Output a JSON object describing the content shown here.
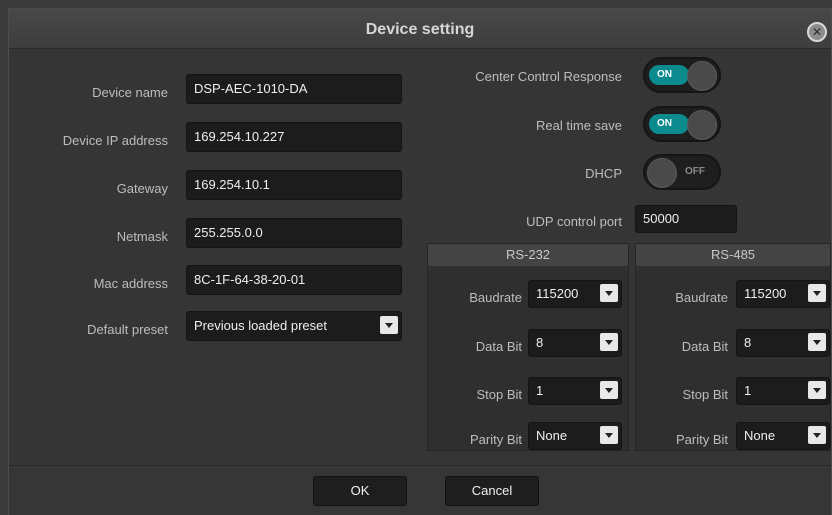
{
  "dialog": {
    "title": "Device setting",
    "close_label": "✕"
  },
  "left": {
    "device_name_label": "Device name",
    "device_name_value": "DSP-AEC-1010-DA",
    "ip_label": "Device IP address",
    "ip_value": "169.254.10.227",
    "gateway_label": "Gateway",
    "gateway_value": "169.254.10.1",
    "netmask_label": "Netmask",
    "netmask_value": "255.255.0.0",
    "mac_label": "Mac address",
    "mac_value": "8C-1F-64-38-20-01",
    "preset_label": "Default preset",
    "preset_value": "Previous loaded preset"
  },
  "right": {
    "center_control_label": "Center Control Response",
    "center_control_state": "ON",
    "realtime_label": "Real time save",
    "realtime_state": "ON",
    "dhcp_label": "DHCP",
    "dhcp_state": "OFF",
    "udp_label": "UDP control port",
    "udp_value": "50000"
  },
  "rs232": {
    "title": "RS-232",
    "baudrate_label": "Baudrate",
    "baudrate_value": "115200",
    "databit_label": "Data Bit",
    "databit_value": "8",
    "stopbit_label": "Stop Bit",
    "stopbit_value": "1",
    "parity_label": "Parity Bit",
    "parity_value": "None"
  },
  "rs485": {
    "title": "RS-485",
    "baudrate_label": "Baudrate",
    "baudrate_value": "115200",
    "databit_label": "Data Bit",
    "databit_value": "8",
    "stopbit_label": "Stop Bit",
    "stopbit_value": "1",
    "parity_label": "Parity Bit",
    "parity_value": "None"
  },
  "footer": {
    "ok_label": "OK",
    "cancel_label": "Cancel"
  },
  "colors": {
    "toggle_on": "#0c8b8f",
    "background": "#353535",
    "field": "#1c1c1c"
  }
}
